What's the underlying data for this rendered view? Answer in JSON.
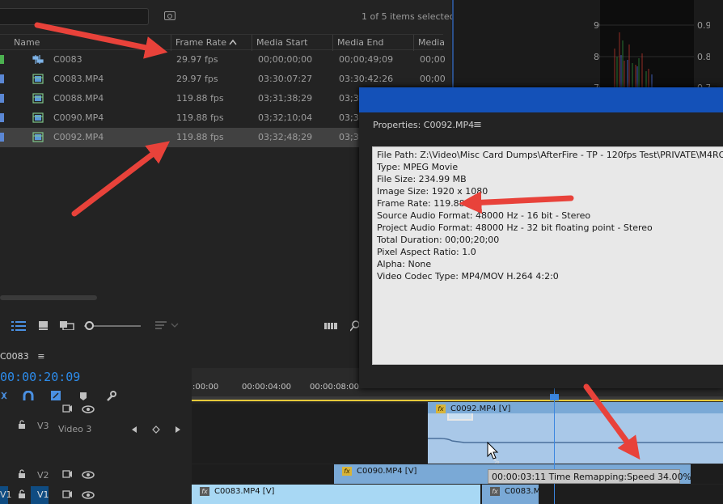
{
  "project": {
    "search_value": "",
    "items_selected": "1 of 5 items selected",
    "columns": [
      "Name",
      "Frame Rate",
      "Media Start",
      "Media End",
      "Media"
    ],
    "rows": [
      {
        "name": "C0083",
        "frame_rate": "29.97 fps",
        "media_start": "00;00;00;00",
        "media_end": "00;00;49;09",
        "media": "00;00",
        "chip": "#4cb150",
        "icon": "sequence-icon"
      },
      {
        "name": "C0083.MP4",
        "frame_rate": "29.97 fps",
        "media_start": "03:30:07:27",
        "media_end": "03:30:42:26",
        "media": "00;00",
        "chip": "#5b87d4",
        "icon": "clip-icon"
      },
      {
        "name": "C0088.MP4",
        "frame_rate": "119.88 fps",
        "media_start": "03;31;38;29",
        "media_end": "03;3",
        "media": "",
        "chip": "#5b87d4",
        "icon": "clip-icon"
      },
      {
        "name": "C0090.MP4",
        "frame_rate": "119.88 fps",
        "media_start": "03;32;10;04",
        "media_end": "03;3",
        "media": "",
        "chip": "#5b87d4",
        "icon": "clip-icon"
      },
      {
        "name": "C0092.MP4",
        "frame_rate": "119.88 fps",
        "media_start": "03;32;48;29",
        "media_end": "03;3",
        "media": "",
        "chip": "#5b87d4",
        "icon": "clip-icon"
      }
    ],
    "selected_row": 4
  },
  "scope": {
    "labels_left": [
      "90",
      "80",
      "70"
    ],
    "labels_right": [
      "0.9",
      "0.8",
      "0.7"
    ]
  },
  "properties": {
    "title": "Properties: C0092.MP4",
    "menu": "≡",
    "lines": [
      "File Path: Z:\\Video\\Misc Card Dumps\\AfterFire - TP - 120fps Test\\PRIVATE\\M4ROOT\\CLI",
      "Type: MPEG Movie",
      "File Size: 234.99 MB",
      "Image Size: 1920 x 1080",
      "Frame Rate: 119.88",
      "Source Audio Format: 48000 Hz - 16 bit - Stereo",
      "Project Audio Format: 48000 Hz - 32 bit floating point - Stereo",
      "Total Duration: 00;00;20;00",
      "Pixel Aspect Ratio: 1.0",
      "Alpha: None",
      "Video Codec Type: MP4/MOV H.264 4:2:0"
    ]
  },
  "timeline": {
    "sequence_tab": "C0083",
    "tab_menu": "≡",
    "timecode": "00:00:20:09",
    "ruler_labels": [
      ":00:00",
      "00:00:04:00",
      "00:00:08:00"
    ],
    "tracks": {
      "v3": {
        "id": "V3",
        "name": "Video 3"
      },
      "v2": {
        "id": "V2"
      },
      "v1": {
        "id": "V1",
        "source": "V1"
      }
    },
    "clips": {
      "v3_clip": "C0092.MP4 [V]",
      "v2_clip": "C0090.MP4 [V]",
      "v1_clip_a": "C0083.MP4 [V]",
      "v1_clip_b": "C0083.M"
    },
    "tooltip": "00:00:03:11  Time Remapping:Speed  34.00%"
  },
  "colors": {
    "accent_blue": "#2d8ceb",
    "dialog_titlebar": "#1451b8",
    "arrow_red": "#e8423a",
    "clip_blue": "#a8d0ee",
    "clip_blue_dark": "#7aa9d6"
  }
}
